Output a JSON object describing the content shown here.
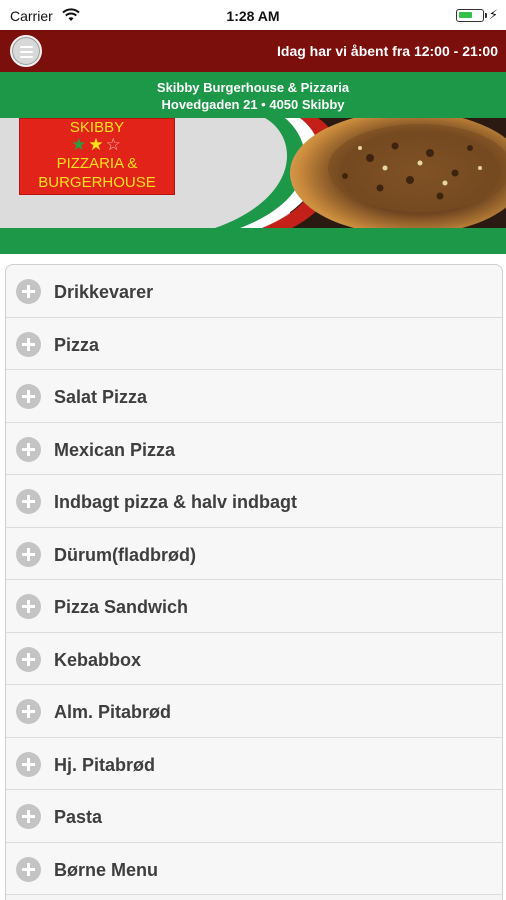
{
  "status_bar": {
    "carrier": "Carrier",
    "time": "1:28 AM",
    "battery_level": 0.6
  },
  "header": {
    "hours": "Idag har vi åbent fra 12:00 - 21:00"
  },
  "restaurant": {
    "name": "Skibby Burgerhouse & Pizzaria",
    "address": "Hovedgaden 21 • 4050 Skibby"
  },
  "logo": {
    "line1": "SKIBBY",
    "stars": [
      "★",
      "★",
      "☆"
    ],
    "line2": "PIZZARIA &",
    "line3": "BURGERHOUSE"
  },
  "menu": {
    "categories": [
      "Drikkevarer",
      "Pizza",
      "Salat Pizza",
      "Mexican Pizza",
      "Indbagt pizza & halv indbagt",
      "Dürum(fladbrød)",
      "Pizza Sandwich",
      "Kebabbox",
      "Alm. Pitabrød",
      "Hj. Pitabrød",
      "Pasta",
      "Børne Menu"
    ]
  },
  "colors": {
    "header_bg": "#7b0f0c",
    "green": "#1d9748",
    "red": "#e2231a",
    "logo_text": "#f8e11a"
  }
}
